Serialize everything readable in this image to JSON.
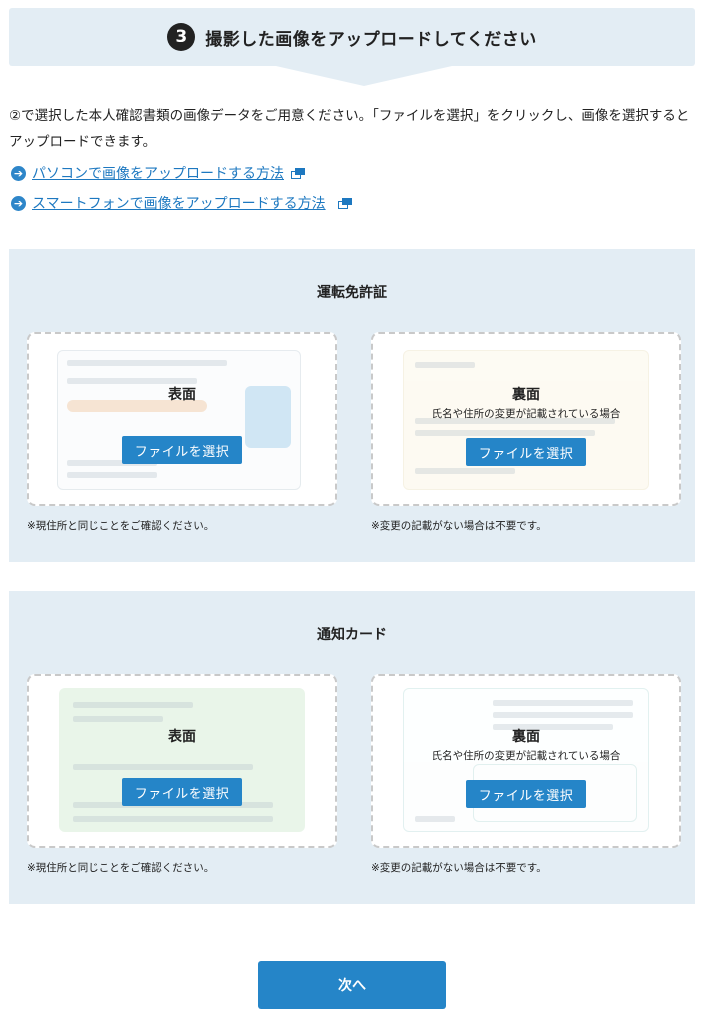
{
  "step": {
    "number": "3",
    "title": "撮影した画像をアップロードしてください"
  },
  "intro_text": "②で選択した本人確認書類の画像データをご用意ください。「ファイルを選択」をクリックし、画像を選択するとアップロードできます。",
  "links": [
    {
      "label": "パソコンで画像をアップロードする方法"
    },
    {
      "label": "スマートフォンで画像をアップロードする方法"
    }
  ],
  "sections": [
    {
      "title": "運転免許証",
      "front": {
        "label": "表面",
        "button": "ファイルを選択",
        "note": "※現住所と同じことをご確認ください。"
      },
      "back": {
        "label": "裏面",
        "sub": "氏名や住所の変更が記載されている場合",
        "button": "ファイルを選択",
        "note": "※変更の記載がない場合は不要です。"
      }
    },
    {
      "title": "通知カード",
      "front": {
        "label": "表面",
        "button": "ファイルを選択",
        "note": "※現住所と同じことをご確認ください。"
      },
      "back": {
        "label": "裏面",
        "sub": "氏名や住所の変更が記載されている場合",
        "button": "ファイルを選択",
        "note": "※変更の記載がない場合は不要です。"
      }
    }
  ],
  "next_button": "次へ",
  "colors": {
    "accent": "#2585c8",
    "link": "#1d78c0",
    "panel": "#e3edf4"
  }
}
